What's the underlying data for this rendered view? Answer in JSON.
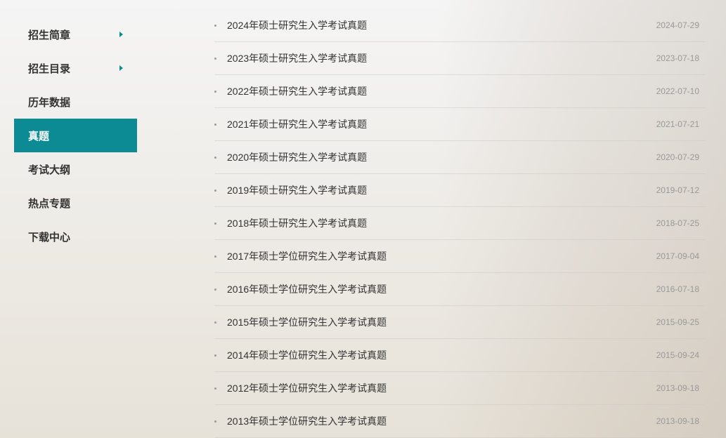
{
  "sidebar": {
    "items": [
      {
        "label": "招生简章",
        "hasChevron": true,
        "active": false
      },
      {
        "label": "招生目录",
        "hasChevron": true,
        "active": false
      },
      {
        "label": "历年数据",
        "hasChevron": false,
        "active": false
      },
      {
        "label": "真题",
        "hasChevron": false,
        "active": true
      },
      {
        "label": "考试大纲",
        "hasChevron": false,
        "active": false
      },
      {
        "label": "热点专题",
        "hasChevron": false,
        "active": false
      },
      {
        "label": "下载中心",
        "hasChevron": false,
        "active": false
      }
    ]
  },
  "list": {
    "items": [
      {
        "title": "2024年硕士研究生入学考试真题",
        "date": "2024-07-29"
      },
      {
        "title": "2023年硕士研究生入学考试真题",
        "date": "2023-07-18"
      },
      {
        "title": "2022年硕士研究生入学考试真题",
        "date": "2022-07-10"
      },
      {
        "title": "2021年硕士研究生入学考试真题",
        "date": "2021-07-21"
      },
      {
        "title": "2020年硕士研究生入学考试真题",
        "date": "2020-07-29"
      },
      {
        "title": "2019年硕士研究生入学考试真题",
        "date": "2019-07-12"
      },
      {
        "title": "2018年硕士研究生入学考试真题",
        "date": "2018-07-25"
      },
      {
        "title": "2017年硕士学位研究生入学考试真题",
        "date": "2017-09-04"
      },
      {
        "title": "2016年硕士学位研究生入学考试真题",
        "date": "2016-07-18"
      },
      {
        "title": "2015年硕士学位研究生入学考试真题",
        "date": "2015-09-25"
      },
      {
        "title": "2014年硕士学位研究生入学考试真题",
        "date": "2015-09-24"
      },
      {
        "title": "2012年硕士学位研究生入学考试真题",
        "date": "2013-09-18"
      },
      {
        "title": "2013年硕士学位研究生入学考试真题",
        "date": "2013-09-18"
      }
    ]
  }
}
